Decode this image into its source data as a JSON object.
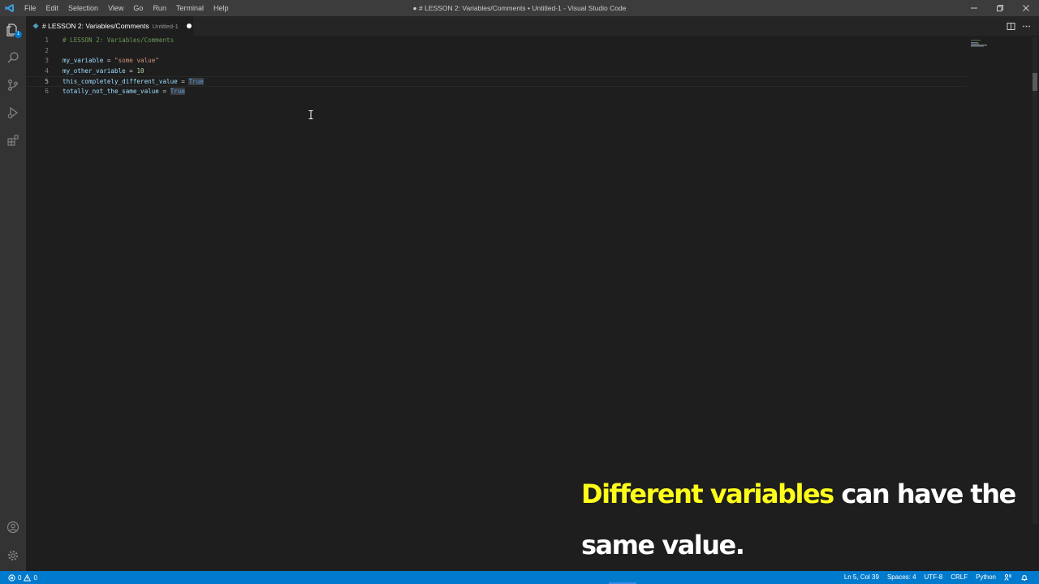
{
  "window": {
    "title": "● # LESSON 2: Variables/Comments • Untitled-1 - Visual Studio Code"
  },
  "menu": [
    "File",
    "Edit",
    "Selection",
    "View",
    "Go",
    "Run",
    "Terminal",
    "Help"
  ],
  "activity_bar": {
    "items": [
      "explorer-icon",
      "search-icon",
      "source-control-icon",
      "run-debug-icon",
      "extensions-icon"
    ],
    "bottom": [
      "accounts-icon",
      "manage-gear-icon"
    ],
    "badge": "1"
  },
  "tab": {
    "title": "# LESSON 2: Variables/Comments",
    "description": "Untitled-1",
    "dirty": true
  },
  "editor": {
    "lines": [
      {
        "num": "1",
        "tokens": [
          {
            "t": "# LESSON 2: Variables/Comments",
            "c": "t-comment"
          }
        ]
      },
      {
        "num": "2",
        "tokens": []
      },
      {
        "num": "3",
        "tokens": [
          {
            "t": "my_variable",
            "c": "t-var"
          },
          {
            "t": " = ",
            "c": "t-plain"
          },
          {
            "t": "\"some value\"",
            "c": "t-str"
          }
        ]
      },
      {
        "num": "4",
        "tokens": [
          {
            "t": "my_other_variable",
            "c": "t-var"
          },
          {
            "t": " = ",
            "c": "t-plain"
          },
          {
            "t": "10",
            "c": "t-num"
          }
        ]
      },
      {
        "num": "5",
        "tokens": [
          {
            "t": "this_completely_different_value",
            "c": "t-var"
          },
          {
            "t": " = ",
            "c": "t-plain"
          },
          {
            "t": "True",
            "c": "t-kw"
          }
        ]
      },
      {
        "num": "6",
        "tokens": [
          {
            "t": "totally_not_the_same_value",
            "c": "t-var"
          },
          {
            "t": " = ",
            "c": "t-plain"
          },
          {
            "t": "True",
            "c": "t-kw"
          }
        ]
      }
    ],
    "current_line": "5"
  },
  "caption": {
    "highlight": "Different variables",
    "rest_line1": " can have the",
    "line2": "same value."
  },
  "status": {
    "errors": "0",
    "warnings": "0",
    "position": "Ln 5, Col 39",
    "spaces": "Spaces: 4",
    "encoding": "UTF-8",
    "eol": "CRLF",
    "language": "Python"
  },
  "colors": {
    "accent": "#007acc",
    "caption_highlight": "#ffff1a"
  }
}
